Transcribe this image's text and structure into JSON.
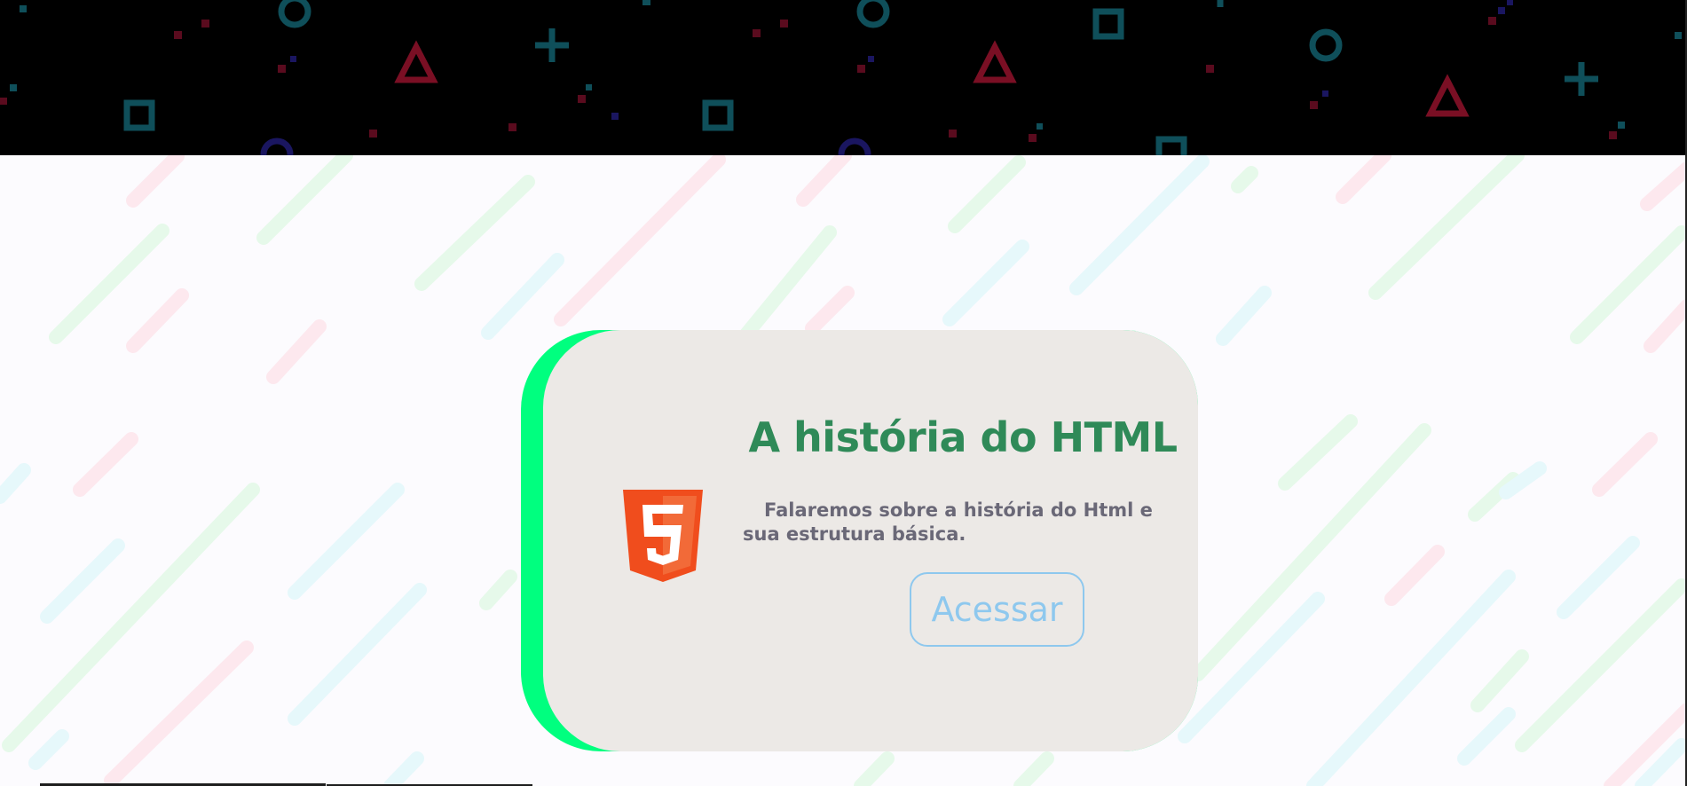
{
  "card": {
    "title": "A história do HTML",
    "description": "Falaremos sobre a história do Html e sua estrutura básica.",
    "button_label": "Acessar",
    "logo_icon": "html5-logo-icon"
  },
  "colors": {
    "header_bg": "#000000",
    "main_bg": "#fcfbfe",
    "card_bg": "#ece9e6",
    "card_accent": "#00ff7f",
    "title": "#2f8a58",
    "description": "#6a6877",
    "button": "#8ec8ee",
    "html5_orange": "#f04d1d"
  }
}
